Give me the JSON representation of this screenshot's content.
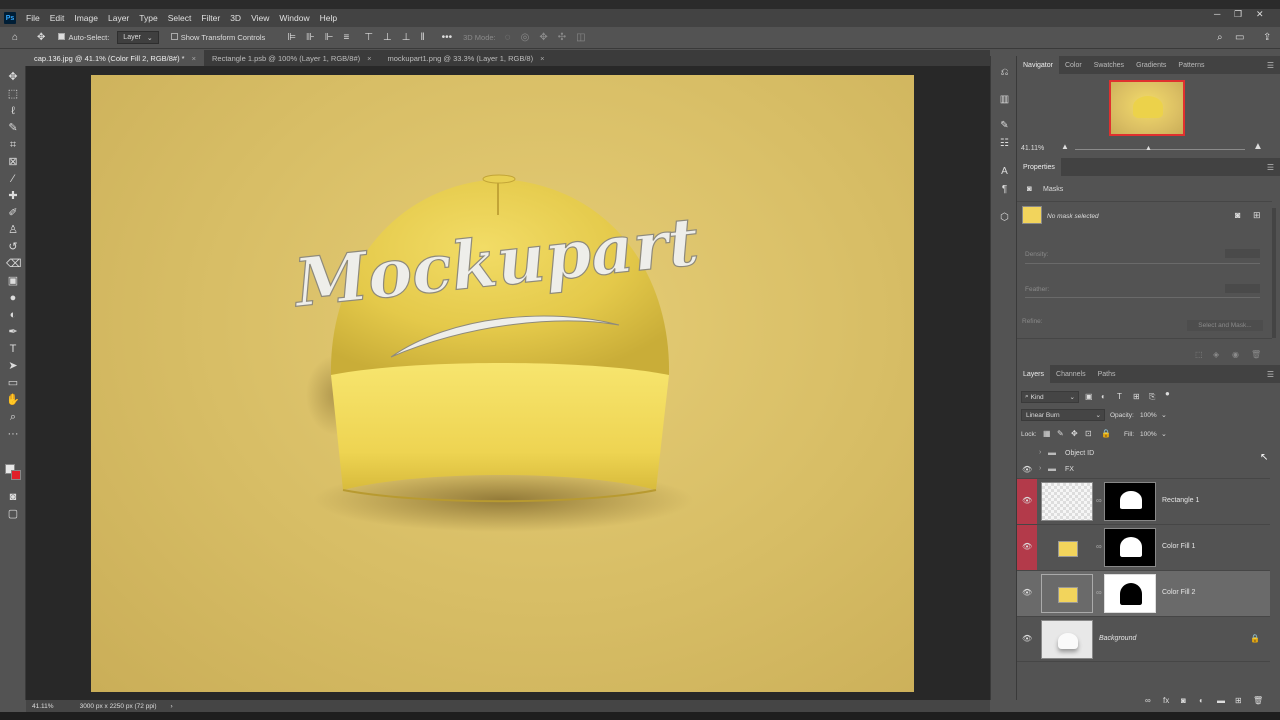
{
  "menu": {
    "app_icon": "Ps",
    "items": [
      "File",
      "Edit",
      "Image",
      "Layer",
      "Type",
      "Select",
      "Filter",
      "3D",
      "View",
      "Window",
      "Help"
    ]
  },
  "options_bar": {
    "auto_select_label": "Auto-Select:",
    "auto_select_target": "Layer",
    "transform_label": "Show Transform Controls",
    "mode_3d_label": "3D Mode:"
  },
  "tabs": [
    {
      "label": "cap.136.jpg @ 41.1% (Color Fill 2, RGB/8#) *",
      "active": true
    },
    {
      "label": "Rectangle 1.psb @ 100% (Layer 1, RGB/8#)",
      "active": false
    },
    {
      "label": "mockupart1.png @ 33.3% (Layer 1, RGB/8)",
      "active": false
    }
  ],
  "canvas": {
    "brand_text": "Mockupart",
    "background_color": "#d6bc65",
    "cap_color": "#e8cf4c"
  },
  "navigator": {
    "tabs": [
      "Navigator",
      "Color",
      "Swatches",
      "Gradients",
      "Patterns"
    ],
    "zoom": "41.11%"
  },
  "properties": {
    "title": "Properties",
    "section": "Masks",
    "status": "No mask selected",
    "density_label": "Density:",
    "feather_label": "Feather:",
    "refine_label": "Refine:",
    "select_mask_label": "Select and Mask..."
  },
  "layers_panel": {
    "tabs": [
      "Layers",
      "Channels",
      "Paths"
    ],
    "filter_kind": "Kind",
    "blend_mode": "Linear Burn",
    "opacity_label": "Opacity:",
    "opacity": "100%",
    "lock_label": "Lock:",
    "fill_label": "Fill:",
    "fill": "100%",
    "groups": [
      {
        "name": "Object ID"
      },
      {
        "name": "FX"
      }
    ],
    "layers": [
      {
        "name": "Rectangle 1"
      },
      {
        "name": "Color Fill 1"
      },
      {
        "name": "Color Fill 2"
      },
      {
        "name": "Background"
      }
    ]
  },
  "status_bar": {
    "zoom": "41.11%",
    "doc_size": "3000 px x 2250 px (72 ppi)"
  },
  "colors": {
    "accent_red": "#b33a4a",
    "fill_swatch": "#f2d45c"
  }
}
